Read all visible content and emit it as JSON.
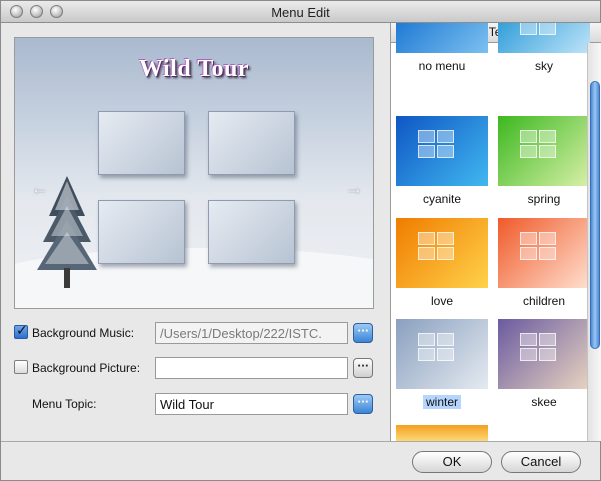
{
  "window": {
    "title": "Menu Edit"
  },
  "preview": {
    "title": "Wild Tour",
    "prev_arrow": "←",
    "next_arrow": "→"
  },
  "form": {
    "bg_music": {
      "label": "Background Music:",
      "checked": true,
      "value": "/Users/1/Desktop/222/ISTC.",
      "browse": "···"
    },
    "bg_picture": {
      "label": "Background Picture:",
      "checked": false,
      "value": "",
      "browse": "···"
    },
    "menu_topic": {
      "label": "Menu Topic:",
      "value": "Wild Tour",
      "browse": "···"
    }
  },
  "templates": {
    "header": "Menu Template",
    "items": [
      {
        "name": "no menu",
        "colors": [
          "#1a76d2",
          "#7cc0f0"
        ]
      },
      {
        "name": "sky",
        "colors": [
          "#2a9ad8",
          "#bfe4f8"
        ]
      },
      {
        "name": "cyanite",
        "colors": [
          "#0f56c4",
          "#41b8f0"
        ]
      },
      {
        "name": "spring",
        "colors": [
          "#3cb820",
          "#d9f0a8"
        ]
      },
      {
        "name": "love",
        "colors": [
          "#f07c00",
          "#ffd24a"
        ]
      },
      {
        "name": "children",
        "colors": [
          "#f05a2a",
          "#ffe0d0"
        ]
      },
      {
        "name": "winter",
        "colors": [
          "#8aa0bf",
          "#e5eaf1"
        ],
        "selected": true
      },
      {
        "name": "skee",
        "colors": [
          "#6a5aa0",
          "#e8d4c0"
        ]
      }
    ]
  },
  "buttons": {
    "ok": "OK",
    "cancel": "Cancel"
  }
}
